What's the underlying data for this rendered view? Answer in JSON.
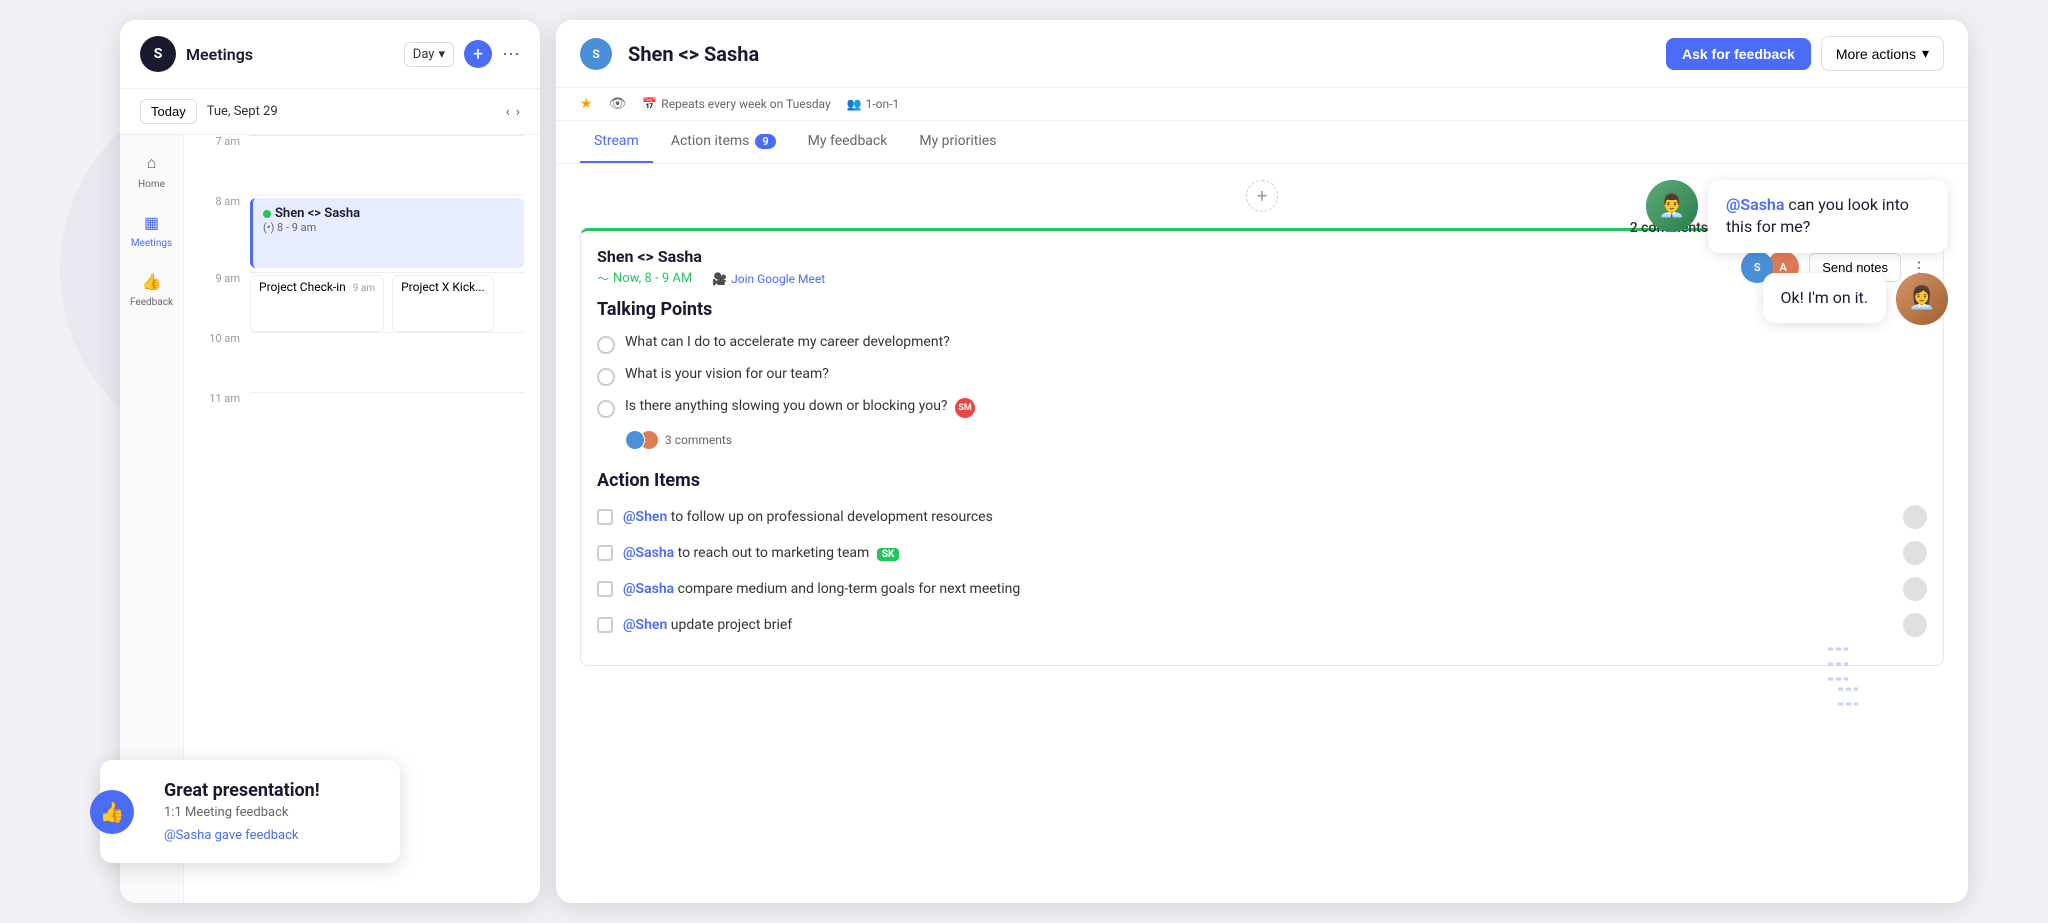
{
  "app": {
    "logo": "S",
    "title": "Meetings"
  },
  "header": {
    "view_selector": "Day",
    "today_label": "Today",
    "date": "Tue, Sept 29",
    "more_actions": "More actions"
  },
  "sidebar_nav": [
    {
      "id": "home",
      "label": "Home",
      "icon": "⌂",
      "active": false
    },
    {
      "id": "meetings",
      "label": "Meetings",
      "icon": "▦",
      "active": true
    },
    {
      "id": "feedback",
      "label": "Feedback",
      "icon": "👍",
      "active": false
    }
  ],
  "calendar": {
    "times": [
      "7 am",
      "8 am",
      "9 am",
      "10 am",
      "11 am"
    ],
    "events": [
      {
        "title": "Shen <> Sasha",
        "time": "(•) 8 - 9 am",
        "slot": "8am",
        "has_indicator": true
      },
      {
        "title": "Project Check-in",
        "time": "9 am",
        "slot": "9am",
        "has_indicator": false
      },
      {
        "title": "Project X Kick...",
        "time": "",
        "slot": "9am",
        "has_indicator": false
      }
    ]
  },
  "main": {
    "title": "Shen <> Sasha",
    "meta": {
      "repeats": "Repeats every week on Tuesday",
      "type": "1-on-1"
    },
    "ask_feedback_btn": "Ask for feedback",
    "more_actions_btn": "More actions",
    "tabs": [
      {
        "id": "stream",
        "label": "Stream",
        "active": true,
        "badge": null
      },
      {
        "id": "action-items",
        "label": "Action items",
        "active": false,
        "badge": "9"
      },
      {
        "id": "my-feedback",
        "label": "My feedback",
        "active": false,
        "badge": null
      },
      {
        "id": "my-priorities",
        "label": "My priorities",
        "active": false,
        "badge": null
      }
    ]
  },
  "meeting_card": {
    "title": "Shen <> Sasha",
    "time": "Now, 8 - 9 AM",
    "join_label": "Join Google Meet",
    "send_notes_btn": "Send notes"
  },
  "talking_points": {
    "section_title": "Talking Points",
    "items": [
      {
        "text": "What can I do to accelerate my career development?",
        "has_badge": false
      },
      {
        "text": "What is your vision for our team?",
        "has_badge": false
      },
      {
        "text": "Is there anything slowing you down or blocking you?",
        "has_badge": true,
        "badge_text": "SM"
      }
    ],
    "comments_count": "3 comments"
  },
  "action_items": {
    "section_title": "Action Items",
    "items": [
      {
        "text_prefix": "@Shen",
        "text_suffix": " to follow up on professional development resources",
        "has_sk_badge": false
      },
      {
        "text_prefix": "@Sasha",
        "text_suffix": " to reach out to marketing team",
        "has_sk_badge": true
      },
      {
        "text_prefix": "@Sasha",
        "text_suffix": " compare medium and long-term goals for next meeting",
        "has_sk_badge": false
      },
      {
        "text_prefix": "@Shen",
        "text_suffix": " update project brief",
        "has_sk_badge": false
      }
    ]
  },
  "feedback_card": {
    "title": "Great presentation!",
    "subtitle": "1:1 Meeting feedback",
    "mention": "@Sasha gave feedback"
  },
  "chat_bubbles": {
    "bubble1": {
      "mention": "@Sasha",
      "text": " can you look into this for me?"
    },
    "bubble2": {
      "text": "Ok! I'm on it."
    }
  },
  "comments_badge": "2 comments"
}
